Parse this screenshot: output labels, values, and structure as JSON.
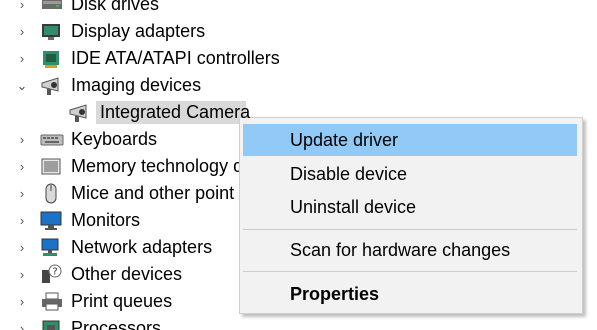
{
  "tree": {
    "items": [
      {
        "label": "Disk drives",
        "icon": "disk-drive-icon",
        "chevron": "›"
      },
      {
        "label": "Display adapters",
        "icon": "display-adapter-icon",
        "chevron": "›"
      },
      {
        "label": "IDE ATA/ATAPI controllers",
        "icon": "ide-controller-icon",
        "chevron": "›"
      },
      {
        "label": "Imaging devices",
        "icon": "camera-icon",
        "chevron": "⌄"
      },
      {
        "label": "Integrated Camera",
        "icon": "camera-icon"
      },
      {
        "label": "Keyboards",
        "icon": "keyboard-icon",
        "chevron": "›"
      },
      {
        "label": "Memory technology d",
        "icon": "memory-icon",
        "chevron": "›"
      },
      {
        "label": "Mice and other point",
        "icon": "mouse-icon",
        "chevron": "›"
      },
      {
        "label": "Monitors",
        "icon": "monitor-icon",
        "chevron": "›"
      },
      {
        "label": "Network adapters",
        "icon": "network-icon",
        "chevron": "›"
      },
      {
        "label": "Other devices",
        "icon": "other-devices-icon",
        "chevron": "›"
      },
      {
        "label": "Print queues",
        "icon": "printer-icon",
        "chevron": "›"
      },
      {
        "label": "Processors",
        "icon": "processor-icon",
        "chevron": "›"
      }
    ]
  },
  "context_menu": {
    "update_driver": "Update driver",
    "disable_device": "Disable device",
    "uninstall_device": "Uninstall device",
    "scan_hardware": "Scan for hardware changes",
    "properties": "Properties"
  },
  "colors": {
    "menu_hover": "#91c9f7",
    "menu_bg": "#f2f2f2",
    "selected_item": "#d9d9d9"
  }
}
